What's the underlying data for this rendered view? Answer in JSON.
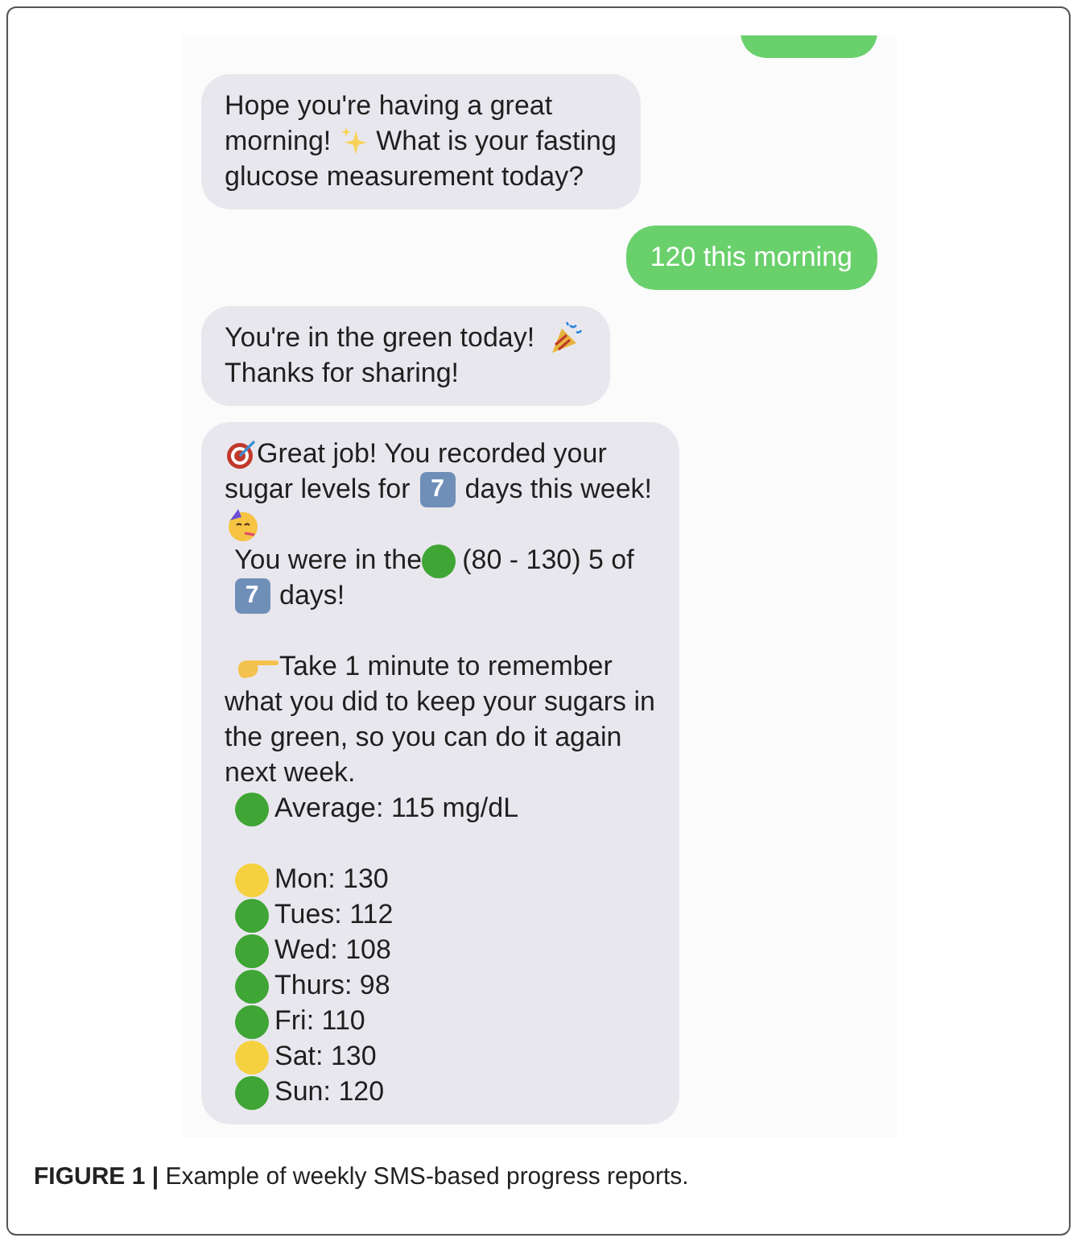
{
  "conversation": [
    {
      "kind": "outgoing",
      "partial": true
    },
    {
      "kind": "incoming",
      "lines": [
        {
          "kind": "text",
          "indent": false,
          "parts": [
            {
              "kind": "text",
              "text": "Hope you're having a great"
            }
          ]
        },
        {
          "kind": "text",
          "indent": false,
          "parts": [
            {
              "kind": "text",
              "text": "morning!"
            },
            {
              "kind": "sparkle"
            },
            {
              "kind": "text",
              "text": "What is your fasting"
            }
          ]
        },
        {
          "kind": "text",
          "indent": false,
          "parts": [
            {
              "kind": "text",
              "text": "glucose measurement today?"
            }
          ]
        }
      ]
    },
    {
      "kind": "outgoing",
      "partial": false,
      "lines": [
        {
          "kind": "text",
          "indent": false,
          "parts": [
            {
              "kind": "text",
              "text": "120 this morning"
            }
          ]
        }
      ]
    },
    {
      "kind": "incoming",
      "lines": [
        {
          "kind": "text",
          "indent": false,
          "parts": [
            {
              "kind": "text",
              "text": "You're in the green today!"
            },
            {
              "kind": "popper"
            }
          ]
        },
        {
          "kind": "text",
          "indent": false,
          "parts": [
            {
              "kind": "text",
              "text": "Thanks for sharing!"
            }
          ]
        }
      ]
    },
    {
      "kind": "incoming",
      "lines": [
        {
          "kind": "text",
          "indent": false,
          "parts": [
            {
              "kind": "target"
            },
            {
              "kind": "text",
              "text": "Great job! You recorded your"
            }
          ]
        },
        {
          "kind": "text",
          "indent": false,
          "parts": [
            {
              "kind": "text",
              "text": "sugar levels for"
            },
            {
              "kind": "keycap",
              "text": "7"
            },
            {
              "kind": "text",
              "text": "days this week!"
            }
          ]
        },
        {
          "kind": "text",
          "indent": false,
          "parts": [
            {
              "kind": "party-face"
            }
          ]
        },
        {
          "kind": "text",
          "indent": true,
          "parts": [
            {
              "kind": "text",
              "text": "You were in the"
            },
            {
              "kind": "dot",
              "color": "#3fa535"
            },
            {
              "kind": "text",
              "text": "(80 - 130) 5 of"
            }
          ]
        },
        {
          "kind": "text",
          "indent": false,
          "parts": [
            {
              "kind": "keycap",
              "text": "7"
            },
            {
              "kind": "text",
              "text": "days!"
            }
          ]
        },
        {
          "kind": "blank"
        },
        {
          "kind": "text",
          "indent": true,
          "parts": [
            {
              "kind": "hand"
            },
            {
              "kind": "text",
              "text": "Take 1 minute to remember"
            }
          ]
        },
        {
          "kind": "text",
          "indent": false,
          "parts": [
            {
              "kind": "text",
              "text": "what you did to keep your sugars in"
            }
          ]
        },
        {
          "kind": "text",
          "indent": false,
          "parts": [
            {
              "kind": "text",
              "text": "the green, so you can do it again"
            }
          ]
        },
        {
          "kind": "text",
          "indent": false,
          "parts": [
            {
              "kind": "text",
              "text": "next week."
            }
          ]
        },
        {
          "kind": "text",
          "indent": true,
          "parts": [
            {
              "kind": "dot",
              "color": "#3fa535"
            },
            {
              "kind": "text",
              "text": "Average: 115 mg/dL"
            }
          ]
        },
        {
          "kind": "blank"
        },
        {
          "kind": "text",
          "indent": true,
          "parts": [
            {
              "kind": "dot",
              "color": "#f5d140"
            },
            {
              "kind": "text",
              "text": "Mon: 130"
            }
          ]
        },
        {
          "kind": "text",
          "indent": true,
          "parts": [
            {
              "kind": "dot",
              "color": "#3fa535"
            },
            {
              "kind": "text",
              "text": "Tues: 112"
            }
          ]
        },
        {
          "kind": "text",
          "indent": true,
          "parts": [
            {
              "kind": "dot",
              "color": "#3fa535"
            },
            {
              "kind": "text",
              "text": "Wed: 108"
            }
          ]
        },
        {
          "kind": "text",
          "indent": true,
          "parts": [
            {
              "kind": "dot",
              "color": "#3fa535"
            },
            {
              "kind": "text",
              "text": "Thurs: 98"
            }
          ]
        },
        {
          "kind": "text",
          "indent": true,
          "parts": [
            {
              "kind": "dot",
              "color": "#3fa535"
            },
            {
              "kind": "text",
              "text": "Fri: 110"
            }
          ]
        },
        {
          "kind": "text",
          "indent": true,
          "parts": [
            {
              "kind": "dot",
              "color": "#f5d140"
            },
            {
              "kind": "text",
              "text": "Sat: 130"
            }
          ]
        },
        {
          "kind": "text",
          "indent": true,
          "parts": [
            {
              "kind": "dot",
              "color": "#3fa535"
            },
            {
              "kind": "text",
              "text": "Sun: 120"
            }
          ]
        }
      ]
    }
  ],
  "caption": "**FIGURE 1 |** Example of weekly SMS-based progress reports."
}
